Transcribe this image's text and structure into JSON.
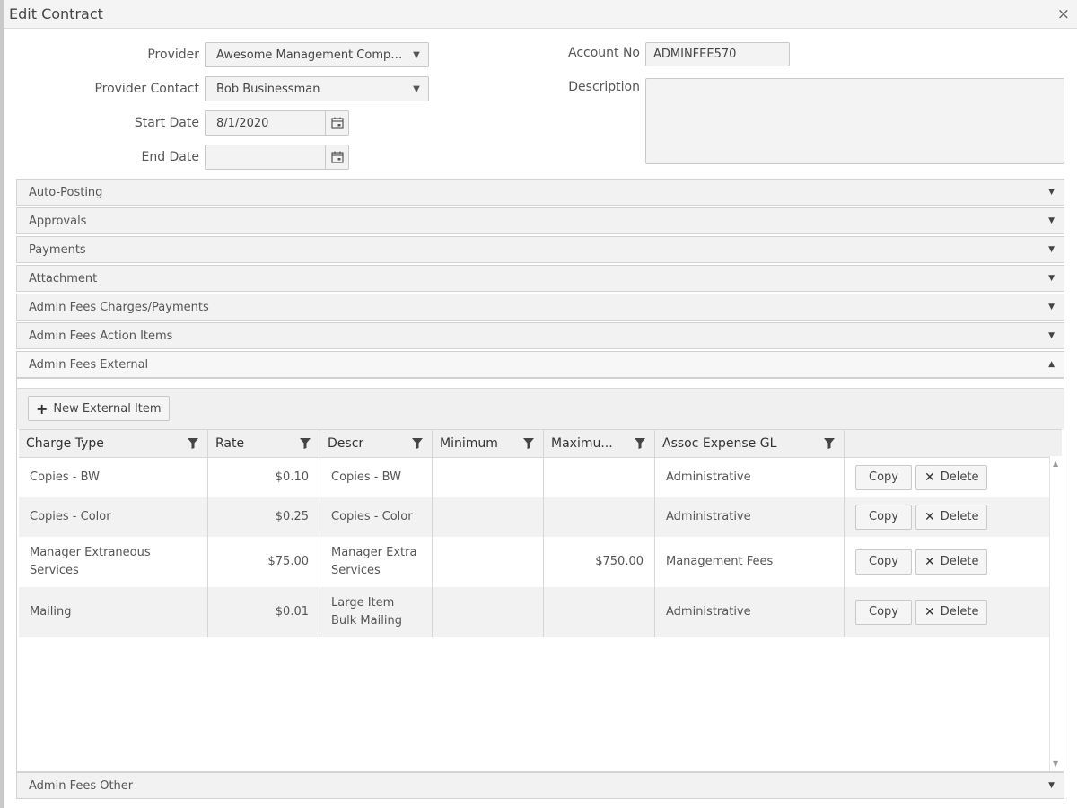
{
  "window": {
    "title": "Edit Contract",
    "close_glyph": "×"
  },
  "form": {
    "provider_label": "Provider",
    "provider_value": "Awesome Management Compan...",
    "contact_label": "Provider Contact",
    "contact_value": "Bob Businessman",
    "start_label": "Start Date",
    "start_value": "8/1/2020",
    "end_label": "End Date",
    "end_value": "",
    "account_label": "Account No",
    "account_value": "ADMINFEE570",
    "description_label": "Description",
    "description_value": ""
  },
  "sections": [
    {
      "label": "Auto-Posting",
      "open": false
    },
    {
      "label": "Approvals",
      "open": false
    },
    {
      "label": "Payments",
      "open": false
    },
    {
      "label": "Attachment",
      "open": false
    },
    {
      "label": "Admin Fees Charges/Payments",
      "open": false
    },
    {
      "label": "Admin Fees Action Items",
      "open": false
    },
    {
      "label": "Admin Fees External",
      "open": true
    },
    {
      "label": "Admin Fees Other",
      "open": false
    }
  ],
  "external": {
    "new_button": "New External Item",
    "columns": [
      "Charge Type",
      "Rate",
      "Descr",
      "Minimum",
      "Maximu...",
      "Assoc Expense GL"
    ],
    "rows": [
      {
        "charge_type": "Copies - BW",
        "rate": "$0.10",
        "descr": "Copies - BW",
        "minimum": "",
        "maximum": "",
        "gl": "Administrative"
      },
      {
        "charge_type": "Copies - Color",
        "rate": "$0.25",
        "descr": "Copies - Color",
        "minimum": "",
        "maximum": "",
        "gl": "Administrative"
      },
      {
        "charge_type": "Manager Extraneous Services",
        "rate": "$75.00",
        "descr": "Manager Extra Services",
        "minimum": "",
        "maximum": "$750.00",
        "gl": "Management Fees"
      },
      {
        "charge_type": "Mailing",
        "rate": "$0.01",
        "descr": "Large Item Bulk Mailing",
        "minimum": "",
        "maximum": "",
        "gl": "Administrative"
      }
    ],
    "copy_label": "Copy",
    "delete_label": "Delete"
  },
  "colors": {
    "accent": "#444444",
    "row_alt": "#f2f2f2",
    "header_bg": "#f0f0f0"
  }
}
